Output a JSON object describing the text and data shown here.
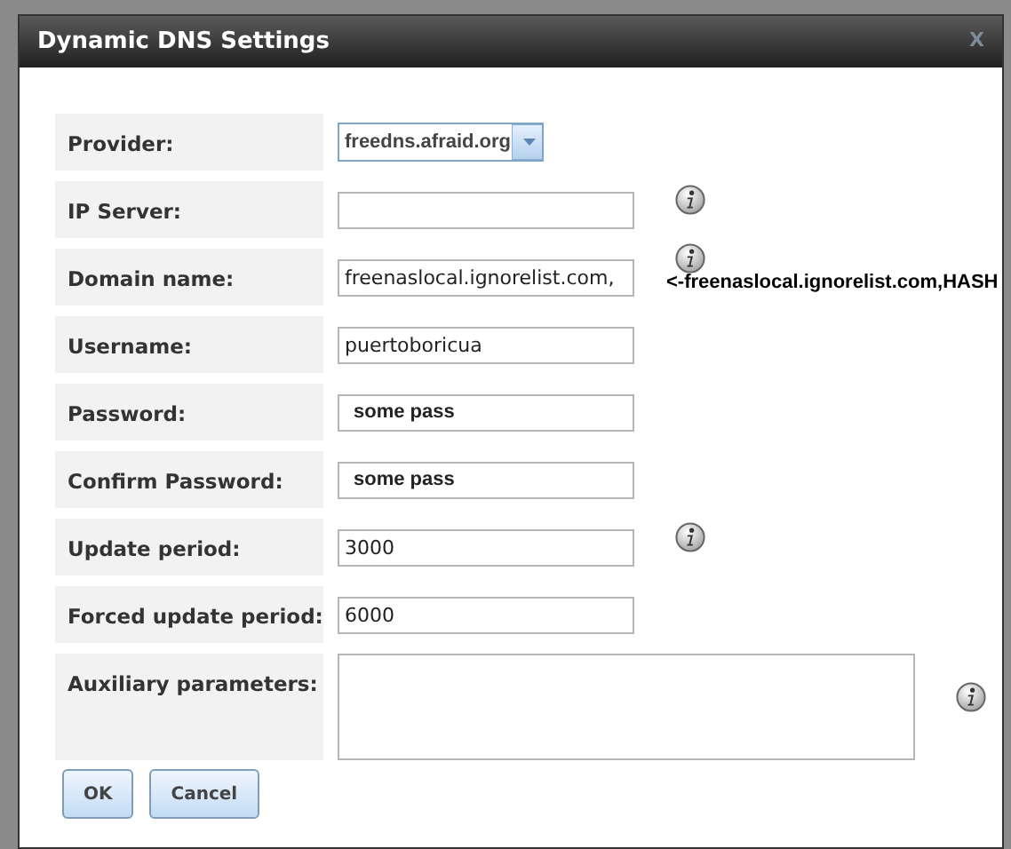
{
  "dialog": {
    "title": "Dynamic DNS Settings",
    "close": "X"
  },
  "fields": [
    {
      "kind": "select",
      "label": "Provider:",
      "value": "freedns.afraid.org",
      "info": false
    },
    {
      "kind": "text",
      "label": "IP Server:",
      "info": true
    },
    {
      "kind": "text",
      "label": "Domain name:",
      "value": "freenaslocal.ignorelist.com,",
      "info": true,
      "note": "<-freenaslocal.ignorelist.com,HASH"
    },
    {
      "kind": "text",
      "label": "Username:",
      "value": "puertoboricua",
      "info": false
    },
    {
      "kind": "password",
      "label": "Password:",
      "value": "some pass",
      "info": false
    },
    {
      "kind": "password",
      "label": "Confirm Password:",
      "value": "some pass",
      "info": false
    },
    {
      "kind": "text",
      "label": "Update period:",
      "value": "3000",
      "info": true
    },
    {
      "kind": "text",
      "label": "Forced update period:",
      "value": "6000",
      "info": false
    },
    {
      "kind": "textarea",
      "label": "Auxiliary parameters:",
      "info": true
    }
  ],
  "buttons": [
    "OK",
    "Cancel"
  ]
}
